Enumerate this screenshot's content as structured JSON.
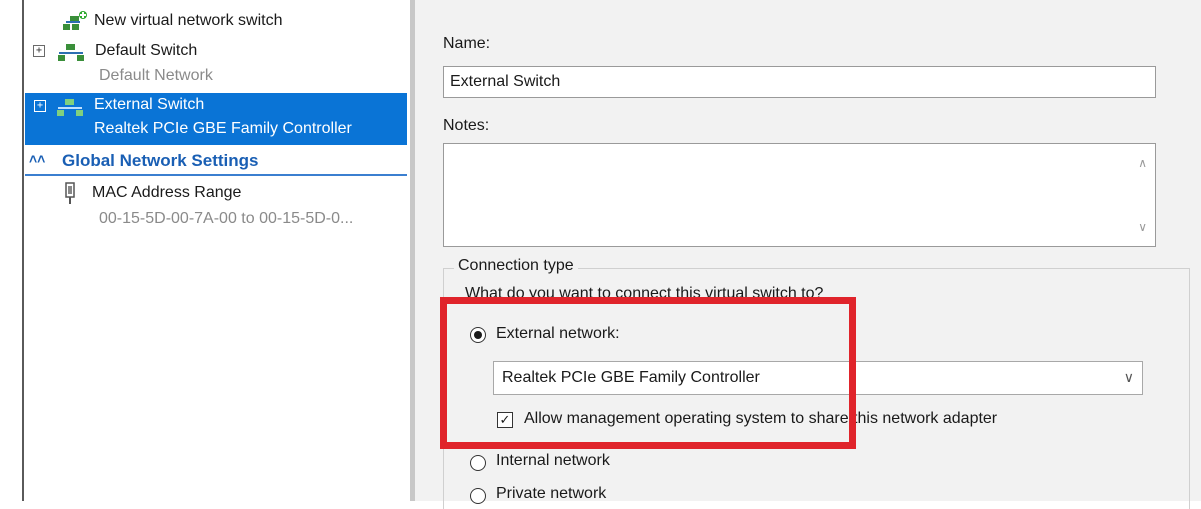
{
  "tree": {
    "new_switch": "New virtual network switch",
    "default_switch": {
      "label": "Default Switch",
      "sub": "Default Network"
    },
    "external_switch": {
      "label": "External Switch",
      "sub": "Realtek PCIe GBE Family Controller"
    },
    "global_settings": "Global Network Settings",
    "mac_range": {
      "label": "MAC Address Range",
      "sub": "00-15-5D-00-7A-00 to 00-15-5D-0..."
    }
  },
  "form": {
    "name_label": "Name:",
    "name_value": "External Switch",
    "notes_label": "Notes:",
    "connection_type_title": "Connection type",
    "question": "What do you want to connect this virtual switch to?",
    "external_label": "External network:",
    "adapter_selected": "Realtek PCIe GBE Family Controller",
    "allow_mgmt_label": "Allow management operating system to share this network adapter",
    "internal_label": "Internal network",
    "private_label": "Private network"
  },
  "colors": {
    "selection": "#0a74d6",
    "link_blue": "#1a5fb4",
    "highlight_red": "#e0242b"
  },
  "icons": {
    "new_switch": "network-add-icon",
    "switch": "network-switch-icon",
    "global_settings": "collapse-chevron-icon",
    "mac_range": "network-adapter-icon"
  }
}
